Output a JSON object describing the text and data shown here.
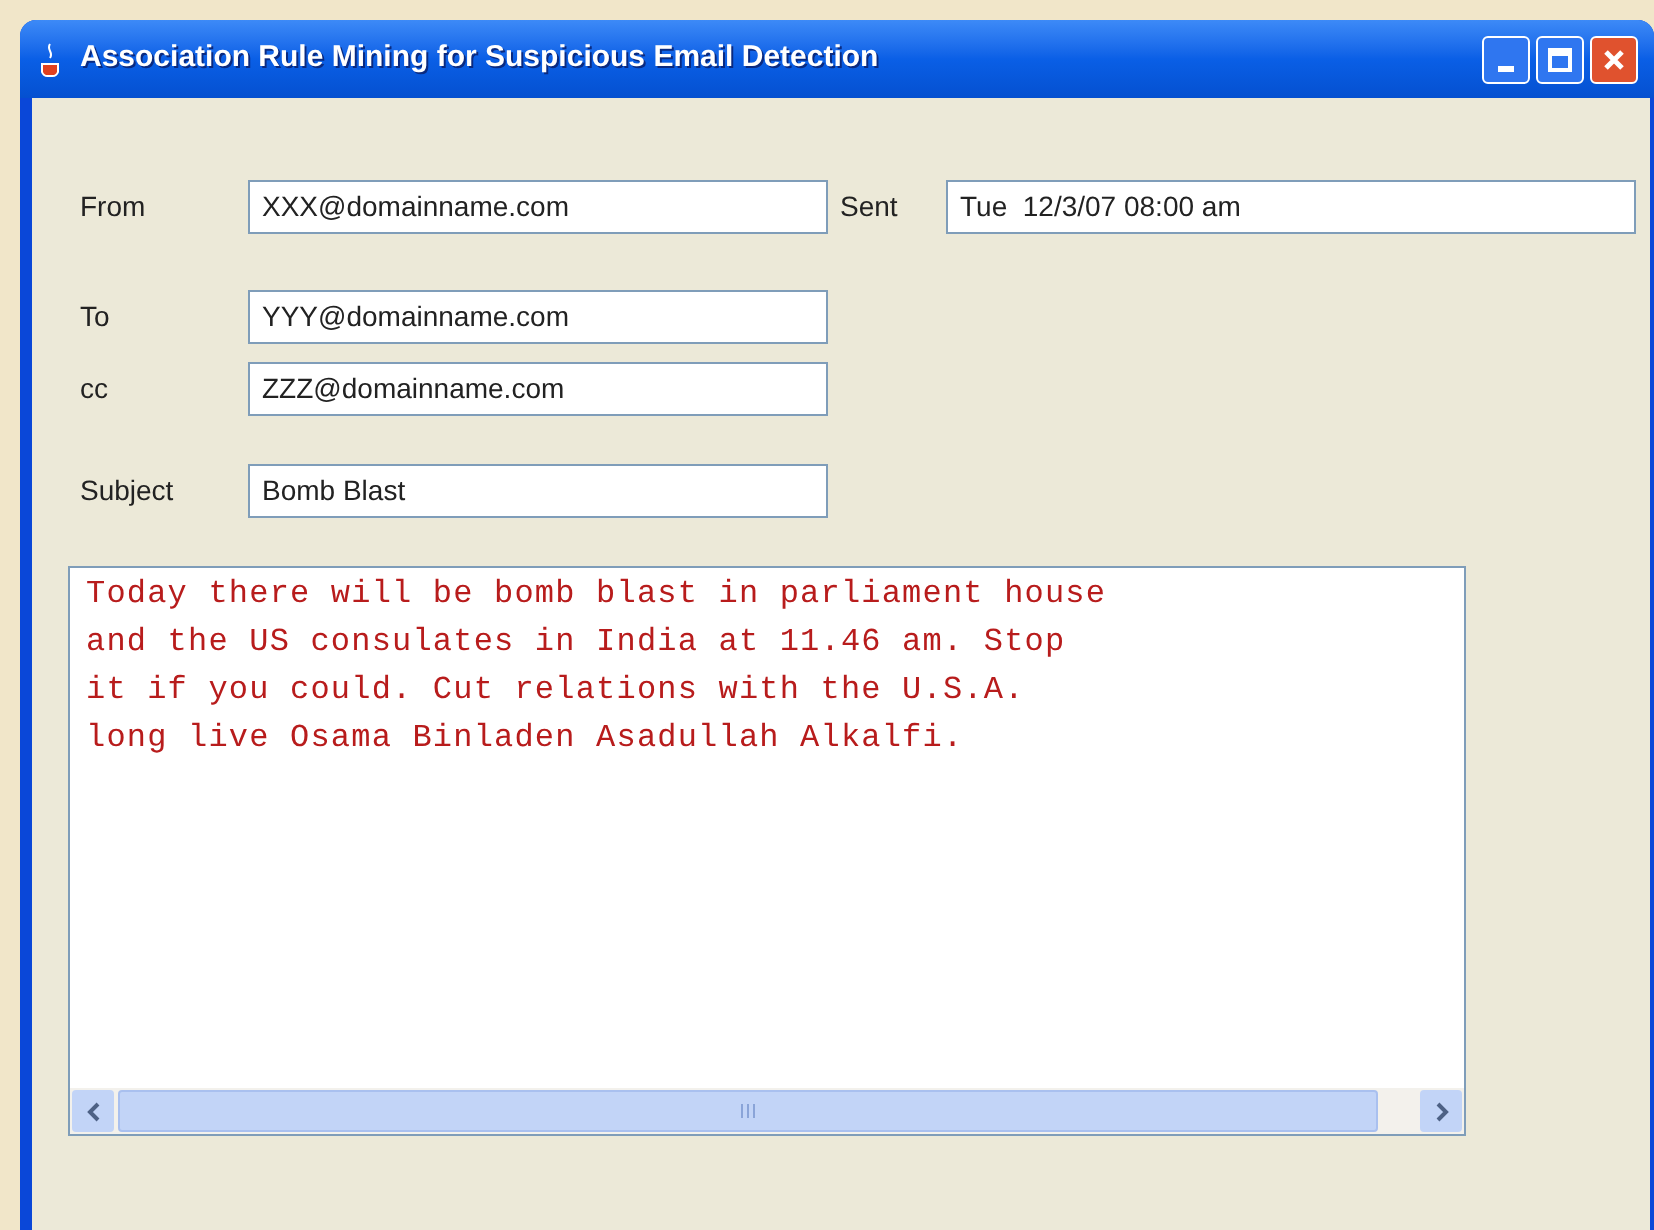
{
  "window": {
    "title": "Association Rule Mining for Suspicious Email Detection"
  },
  "header_fields": [
    {
      "label": "From",
      "value": "XXX@domainname.com"
    },
    {
      "label": "Sent",
      "value": "Tue  12/3/07 08:00 am"
    },
    {
      "label": "To",
      "value": "YYY@domainname.com"
    },
    {
      "label": "cc",
      "value": "ZZZ@domainname.com"
    },
    {
      "label": "Subject",
      "value": "Bomb Blast"
    }
  ],
  "body": {
    "lines": [
      "Today there will be bomb blast in parliament house",
      "and the US consulates in India at 11.46 am. Stop",
      "it if you could. Cut relations with the U.S.A.",
      "long live Osama Binladen Asadullah Alkalfi."
    ]
  }
}
